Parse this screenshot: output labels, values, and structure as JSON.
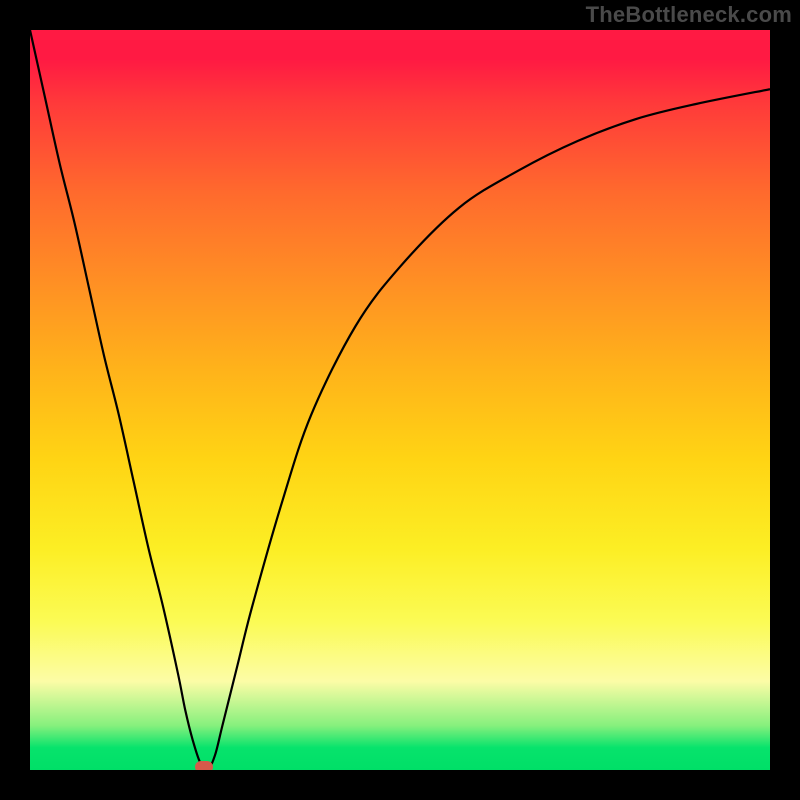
{
  "watermark": "TheBottleneck.com",
  "colors": {
    "page_bg": "#000000",
    "watermark": "#4a4a4a",
    "curve": "#000000",
    "marker": "#d65a4a",
    "gradient_top": "#ff1a43",
    "gradient_bottom": "#00df67"
  },
  "chart_data": {
    "type": "line",
    "title": "",
    "xlabel": "",
    "ylabel": "",
    "x": [
      0,
      2,
      4,
      6,
      8,
      10,
      12,
      14,
      16,
      18,
      20,
      21,
      22,
      23,
      24,
      25,
      26,
      28,
      30,
      34,
      38,
      44,
      50,
      58,
      66,
      74,
      82,
      90,
      100
    ],
    "values": [
      100,
      91,
      82,
      74,
      65,
      56,
      48,
      39,
      30,
      22,
      13,
      8,
      4,
      1,
      0,
      2,
      6,
      14,
      22,
      36,
      48,
      60,
      68,
      76,
      81,
      85,
      88,
      90,
      92
    ],
    "xlim": [
      0,
      100
    ],
    "ylim": [
      0,
      100
    ],
    "marker_point": {
      "x": 23.5,
      "y": 0
    },
    "annotations": []
  }
}
